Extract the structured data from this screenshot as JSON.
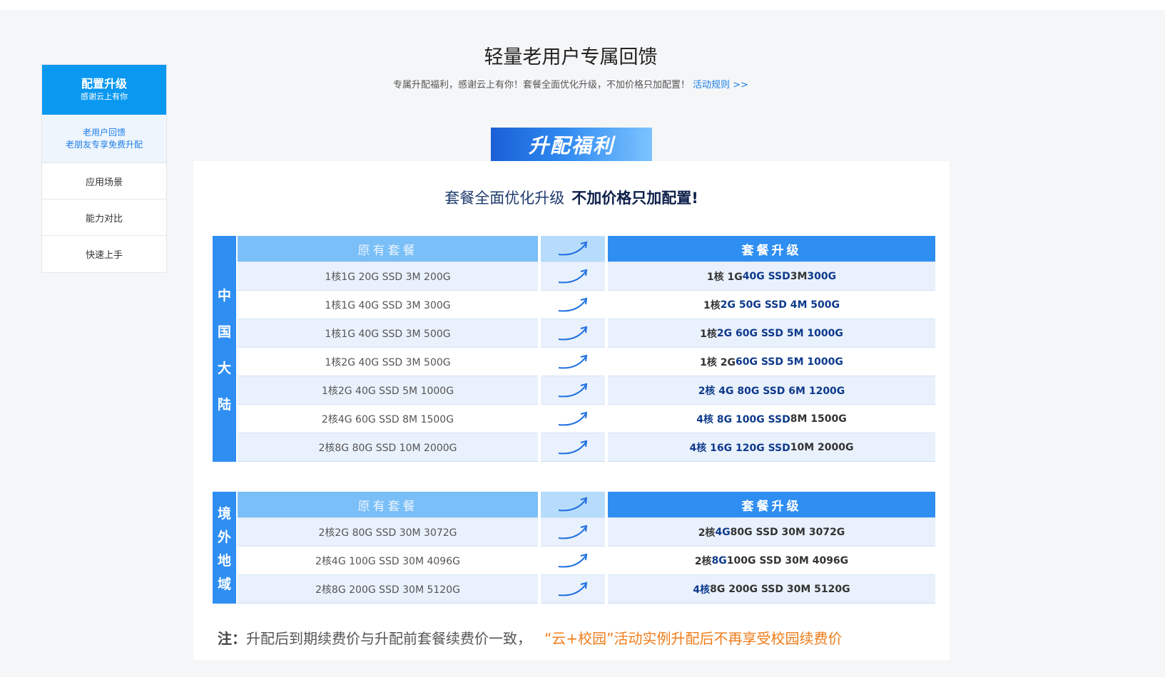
{
  "sidebar": {
    "active": {
      "title": "配置升级",
      "subtitle": "感谢云上有你"
    },
    "sub": {
      "line1": "老用户回馈",
      "line2": "老朋友专享免费升配"
    },
    "items": [
      "应用场景",
      "能力对比",
      "快速上手"
    ]
  },
  "header": {
    "title": "轻量老用户专属回馈",
    "subtitle": "专属升配福利，感谢云上有你！套餐全面优化升级，不加价格只加配置！",
    "rule_link": "活动规则 >>"
  },
  "banner": "升配福利",
  "headline": {
    "normal": "套餐全面优化升级",
    "bold": "不加价格只加配置!"
  },
  "columns": {
    "original": "原有套餐",
    "upgrade": "套餐升级"
  },
  "groups": [
    {
      "label": "中国大陆",
      "rows": [
        {
          "original": "1核1G 20G SSD 3M 200G",
          "upgrade": [
            [
              "1核 1G ",
              false
            ],
            [
              "40G SSD",
              true
            ],
            [
              " 3M ",
              false
            ],
            [
              "300G",
              true
            ]
          ]
        },
        {
          "original": "1核1G 40G SSD 3M 300G",
          "upgrade": [
            [
              "1核 ",
              false
            ],
            [
              "2G 50G SSD 4M 500G",
              true
            ]
          ]
        },
        {
          "original": "1核1G 40G SSD 3M 500G",
          "upgrade": [
            [
              "1核 ",
              false
            ],
            [
              "2G 60G SSD 5M 1000G",
              true
            ]
          ]
        },
        {
          "original": "1核2G 40G SSD 3M 500G",
          "upgrade": [
            [
              "1核 2G ",
              false
            ],
            [
              "60G SSD 5M 1000G",
              true
            ]
          ]
        },
        {
          "original": "1核2G 40G SSD 5M 1000G",
          "upgrade": [
            [
              "2核 4G 80G SSD 6M 1200G",
              true
            ]
          ]
        },
        {
          "original": "2核4G 60G SSD 8M 1500G",
          "upgrade": [
            [
              "4核 8G 100G SSD",
              true
            ],
            [
              " 8M 1500G",
              false
            ]
          ]
        },
        {
          "original": "2核8G 80G SSD 10M 2000G",
          "upgrade": [
            [
              "4核 16G 120G SSD",
              true
            ],
            [
              " 10M 2000G",
              false
            ]
          ]
        }
      ]
    },
    {
      "label": "境外地域",
      "rows": [
        {
          "original": "2核2G 80G SSD 30M 3072G",
          "upgrade": [
            [
              "2核 ",
              false
            ],
            [
              "4G",
              true
            ],
            [
              " 80G SSD 30M 3072G",
              false
            ]
          ]
        },
        {
          "original": "2核4G 100G SSD 30M 4096G",
          "upgrade": [
            [
              "2核 ",
              false
            ],
            [
              "8G",
              true
            ],
            [
              " 100G SSD 30M 4096G",
              false
            ]
          ]
        },
        {
          "original": "2核8G 200G SSD 30M 5120G",
          "upgrade": [
            [
              "4核",
              true
            ],
            [
              " 8G 200G SSD 30M 5120G",
              false
            ]
          ]
        }
      ]
    }
  ],
  "note": {
    "label": "注：",
    "text": "升配后到期续费价与升配前套餐续费价一致，",
    "highlight": "“云+校园”活动实例升配后不再享受校园续费价"
  },
  "colors": {
    "accent": "#2f8ef2",
    "sidebar_active": "#0a98f0",
    "highlight": "#f07c1a",
    "upgrade_text": "#0e3a8c"
  }
}
